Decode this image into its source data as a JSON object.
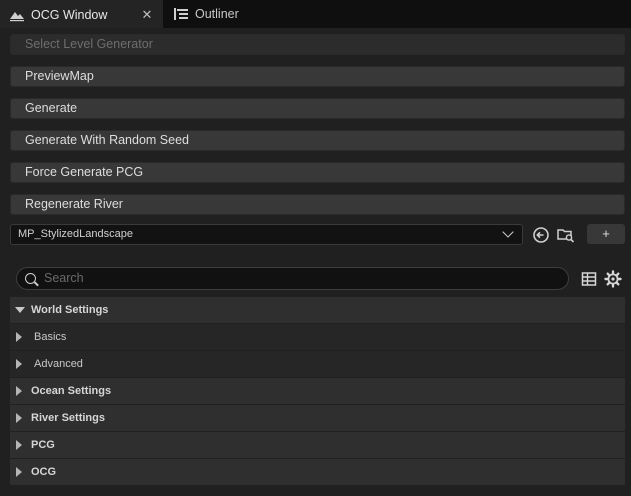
{
  "tabs": [
    {
      "label": "OCG Window",
      "active": true,
      "close": "✕"
    },
    {
      "label": "Outliner",
      "active": false
    }
  ],
  "buttons": [
    {
      "label": "Select Level Generator",
      "disabled": true
    },
    {
      "label": "PreviewMap"
    },
    {
      "label": "Generate"
    },
    {
      "label": "Generate With Random Seed"
    },
    {
      "label": "Force Generate PCG"
    },
    {
      "label": "Regenerate River"
    }
  ],
  "asset_picker": {
    "value": "MP_StylizedLandscape",
    "add_label": "+"
  },
  "search": {
    "placeholder": "Search"
  },
  "details": [
    {
      "label": "World Settings",
      "kind": "category",
      "expanded": true
    },
    {
      "label": "Basics",
      "kind": "sub"
    },
    {
      "label": "Advanced",
      "kind": "sub"
    },
    {
      "label": "Ocean Settings",
      "kind": "category"
    },
    {
      "label": "River Settings",
      "kind": "category"
    },
    {
      "label": "PCG",
      "kind": "category"
    },
    {
      "label": "OCG",
      "kind": "category"
    }
  ],
  "colors": {
    "panel": "#202020",
    "button": "#383838",
    "category": "#2f2f2f"
  }
}
